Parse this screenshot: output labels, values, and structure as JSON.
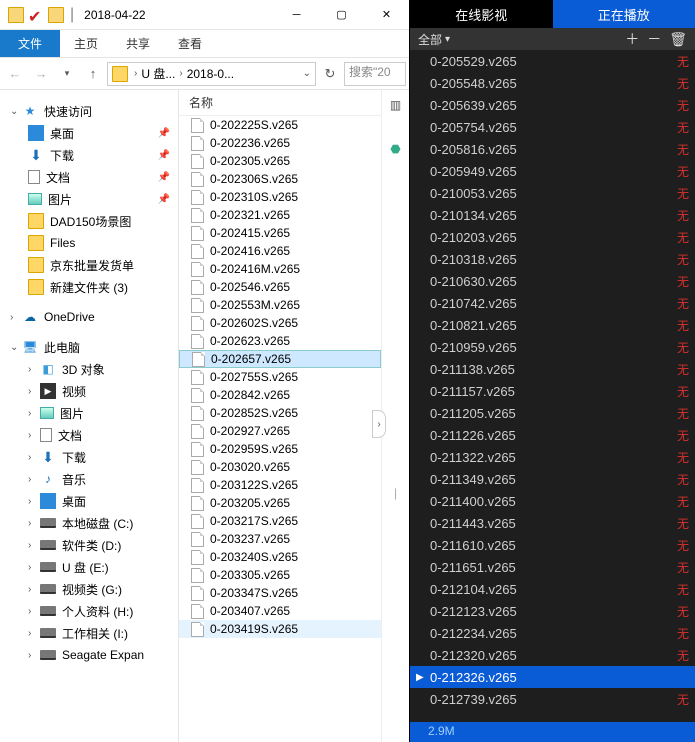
{
  "explorer": {
    "titlebar": {
      "title": "2018-04-22"
    },
    "menu": {
      "file": "文件",
      "home": "主页",
      "share": "共享",
      "view": "查看"
    },
    "breadcrumb": {
      "seg1": "U 盘...",
      "seg2": "2018-0..."
    },
    "search_placeholder": "搜索\"20",
    "column_name": "名称",
    "tree": {
      "quick_access": "快速访问",
      "desktop": "桌面",
      "downloads": "下载",
      "documents": "文档",
      "pictures": "图片",
      "dad": "DAD150场景图",
      "files": "Files",
      "jd": "京东批量发货单",
      "newfolder": "新建文件夹 (3)",
      "onedrive": "OneDrive",
      "thispc": "此电脑",
      "threed": "3D 对象",
      "videos": "视频",
      "pictures2": "图片",
      "documents2": "文档",
      "downloads2": "下载",
      "music": "音乐",
      "desktop2": "桌面",
      "cdrive": "本地磁盘 (C:)",
      "ddrive": "软件类 (D:)",
      "edrive": "U 盘 (E:)",
      "gdrive": "视频类 (G:)",
      "hdrive": "个人资料 (H:)",
      "idrive": "工作相关 (I:)",
      "seagate": "Seagate Expan"
    },
    "files": [
      "0-202225S.v265",
      "0-202236.v265",
      "0-202305.v265",
      "0-202306S.v265",
      "0-202310S.v265",
      "0-202321.v265",
      "0-202415.v265",
      "0-202416.v265",
      "0-202416M.v265",
      "0-202546.v265",
      "0-202553M.v265",
      "0-202602S.v265",
      "0-202623.v265",
      "0-202657.v265",
      "0-202755S.v265",
      "0-202842.v265",
      "0-202852S.v265",
      "0-202927.v265",
      "0-202959S.v265",
      "0-203020.v265",
      "0-203122S.v265",
      "0-203205.v265",
      "0-203217S.v265",
      "0-203237.v265",
      "0-203240S.v265",
      "0-203305.v265",
      "0-203347S.v265",
      "0-203407.v265",
      "0-203419S.v265"
    ],
    "selected_index": 13,
    "hover_index": 28
  },
  "player": {
    "tab_online": "在线影视",
    "tab_playing": "正在播放",
    "filter_all": "全部",
    "status_size": "2.9M",
    "playing_index": 28,
    "items": [
      "0-205529.v265",
      "0-205548.v265",
      "0-205639.v265",
      "0-205754.v265",
      "0-205816.v265",
      "0-205949.v265",
      "0-210053.v265",
      "0-210134.v265",
      "0-210203.v265",
      "0-210318.v265",
      "0-210630.v265",
      "0-210742.v265",
      "0-210821.v265",
      "0-210959.v265",
      "0-211138.v265",
      "0-211157.v265",
      "0-211205.v265",
      "0-211226.v265",
      "0-211322.v265",
      "0-211349.v265",
      "0-211400.v265",
      "0-211443.v265",
      "0-211610.v265",
      "0-211651.v265",
      "0-212104.v265",
      "0-212123.v265",
      "0-212234.v265",
      "0-212320.v265",
      "0-212326.v265",
      "0-212739.v265"
    ],
    "tag": "无"
  }
}
